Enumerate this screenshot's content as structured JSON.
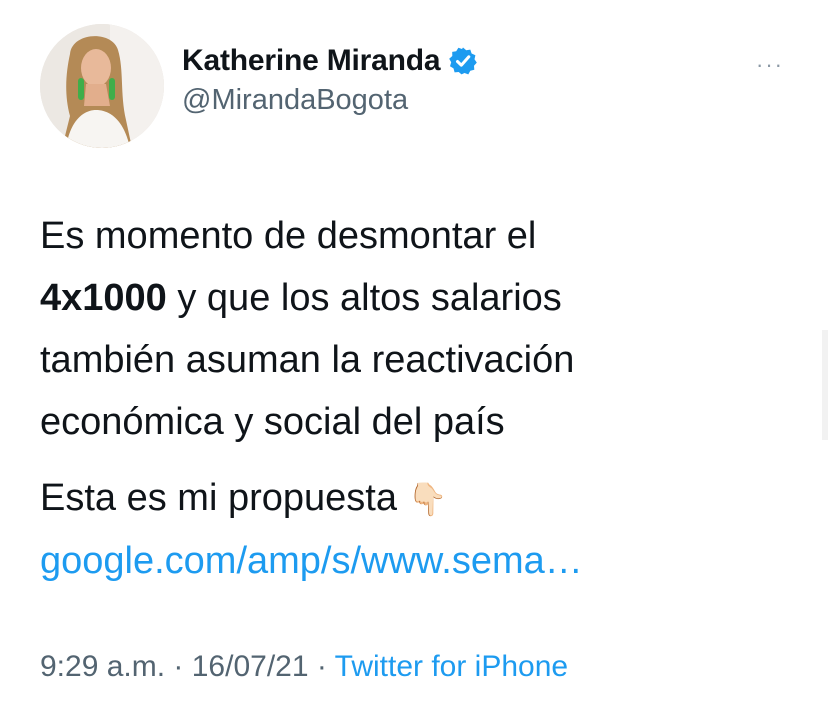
{
  "author": {
    "display_name": "Katherine Miranda",
    "handle": "@MirandaBogota",
    "verified": true
  },
  "more_menu": {
    "icon": "more-horizontal-icon",
    "label": "···"
  },
  "tweet": {
    "line1": "Es momento de desmontar el",
    "bold": "4x1000",
    "line2_rest": " y que los altos salarios",
    "line3": "también asuman la reactivación",
    "line4": "económica y social del país",
    "line5": "Esta es mi propuesta ",
    "emoji": "👇🏻",
    "link": "google.com/amp/s/www.sema…"
  },
  "meta": {
    "time": "9:29 a.m.",
    "separator1": " · ",
    "date": "16/07/21",
    "separator2": " · ",
    "source": "Twitter for iPhone"
  },
  "colors": {
    "link": "#1d9bf0",
    "secondary_text": "#536471",
    "verified_badge": "#1d9bf0"
  }
}
